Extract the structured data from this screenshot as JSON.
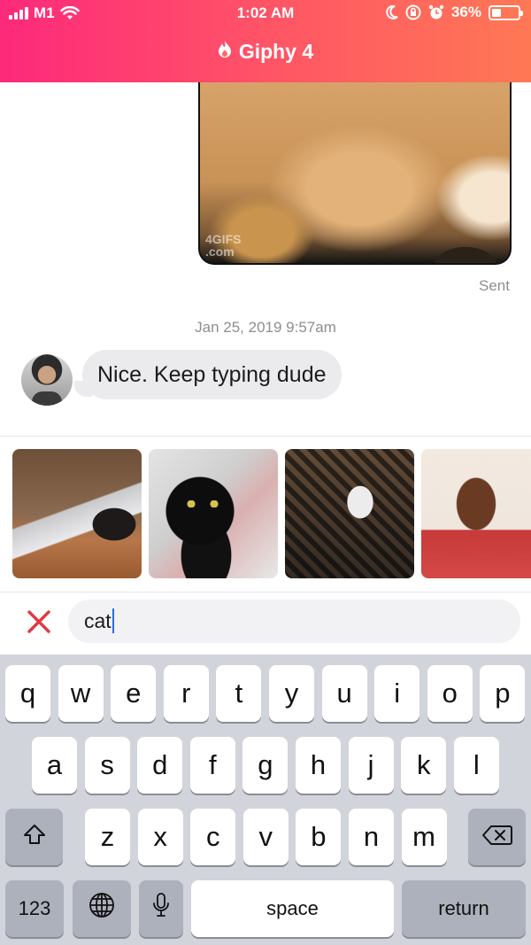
{
  "status_bar": {
    "carrier": "M1",
    "time": "1:02 AM",
    "battery_percent": "36%",
    "battery_level": 0.36
  },
  "header": {
    "title": "Giphy 4",
    "icon": "flame-icon",
    "gradient": [
      "#fd297b",
      "#ff5864",
      "#ff7854"
    ]
  },
  "chat": {
    "sent_gif_watermark": "4GIFS\n.com",
    "sent_status": "Sent",
    "timestamp": "Jan 25, 2019 9:57am",
    "incoming_message": "Nice. Keep typing dude"
  },
  "gif_results": [
    {
      "subject": "cat typing on laptop"
    },
    {
      "subject": "black cat"
    },
    {
      "subject": "white cat on rug"
    },
    {
      "subject": "man in red shirt"
    }
  ],
  "search": {
    "clear_icon": "close-icon",
    "query": "cat",
    "accent_color": "#e0393e"
  },
  "keyboard": {
    "row1": [
      "q",
      "w",
      "e",
      "r",
      "t",
      "y",
      "u",
      "i",
      "o",
      "p"
    ],
    "row2": [
      "a",
      "s",
      "d",
      "f",
      "g",
      "h",
      "j",
      "k",
      "l"
    ],
    "row3": [
      "z",
      "x",
      "c",
      "v",
      "b",
      "n",
      "m"
    ],
    "numbers_label": "123",
    "space_label": "space",
    "return_label": "return",
    "shift_icon": "shift-icon",
    "delete_icon": "backspace-icon",
    "globe_icon": "globe-icon",
    "mic_icon": "microphone-icon"
  }
}
